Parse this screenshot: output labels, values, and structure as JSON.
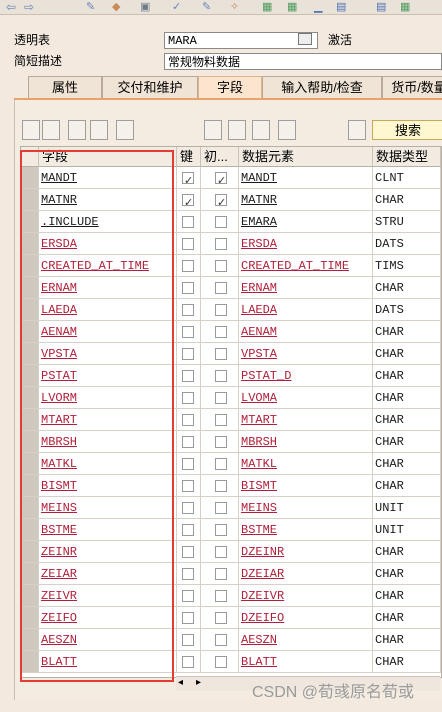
{
  "header": {
    "table_label": "透明表",
    "table_name": "MARA",
    "status": "激活",
    "short_desc_label": "简短描述",
    "short_desc_value": "常规物料数据"
  },
  "tabs": [
    {
      "label": "属性"
    },
    {
      "label": "交付和维护"
    },
    {
      "label": "字段"
    },
    {
      "label": "输入帮助/检查"
    },
    {
      "label": "货币/数量"
    }
  ],
  "toolbar": {
    "search_label": "搜索"
  },
  "grid": {
    "columns": [
      "字段",
      "键",
      "初...",
      "数据元素",
      "数据类型"
    ],
    "rows": [
      {
        "field": "MANDT",
        "key": true,
        "init": true,
        "element": "MANDT",
        "type": "CLNT",
        "red": false
      },
      {
        "field": "MATNR",
        "key": true,
        "init": true,
        "element": "MATNR",
        "type": "CHAR",
        "red": false
      },
      {
        "field": ".INCLUDE",
        "key": false,
        "init": false,
        "element": "EMARA",
        "type": "STRU",
        "red": false
      },
      {
        "field": "ERSDA",
        "key": false,
        "init": false,
        "element": "ERSDA",
        "type": "DATS",
        "red": true
      },
      {
        "field": "CREATED_AT_TIME",
        "key": false,
        "init": false,
        "element": "CREATED_AT_TIME",
        "type": "TIMS",
        "red": true
      },
      {
        "field": "ERNAM",
        "key": false,
        "init": false,
        "element": "ERNAM",
        "type": "CHAR",
        "red": true
      },
      {
        "field": "LAEDA",
        "key": false,
        "init": false,
        "element": "LAEDA",
        "type": "DATS",
        "red": true
      },
      {
        "field": "AENAM",
        "key": false,
        "init": false,
        "element": "AENAM",
        "type": "CHAR",
        "red": true
      },
      {
        "field": "VPSTA",
        "key": false,
        "init": false,
        "element": "VPSTA",
        "type": "CHAR",
        "red": true
      },
      {
        "field": "PSTAT",
        "key": false,
        "init": false,
        "element": "PSTAT_D",
        "type": "CHAR",
        "red": true
      },
      {
        "field": "LVORM",
        "key": false,
        "init": false,
        "element": "LVOMA",
        "type": "CHAR",
        "red": true
      },
      {
        "field": "MTART",
        "key": false,
        "init": false,
        "element": "MTART",
        "type": "CHAR",
        "red": true
      },
      {
        "field": "MBRSH",
        "key": false,
        "init": false,
        "element": "MBRSH",
        "type": "CHAR",
        "red": true
      },
      {
        "field": "MATKL",
        "key": false,
        "init": false,
        "element": "MATKL",
        "type": "CHAR",
        "red": true
      },
      {
        "field": "BISMT",
        "key": false,
        "init": false,
        "element": "BISMT",
        "type": "CHAR",
        "red": true
      },
      {
        "field": "MEINS",
        "key": false,
        "init": false,
        "element": "MEINS",
        "type": "UNIT",
        "red": true
      },
      {
        "field": "BSTME",
        "key": false,
        "init": false,
        "element": "BSTME",
        "type": "UNIT",
        "red": true
      },
      {
        "field": "ZEINR",
        "key": false,
        "init": false,
        "element": "DZEINR",
        "type": "CHAR",
        "red": true
      },
      {
        "field": "ZEIAR",
        "key": false,
        "init": false,
        "element": "DZEIAR",
        "type": "CHAR",
        "red": true
      },
      {
        "field": "ZEIVR",
        "key": false,
        "init": false,
        "element": "DZEIVR",
        "type": "CHAR",
        "red": true
      },
      {
        "field": "ZEIFO",
        "key": false,
        "init": false,
        "element": "DZEIFO",
        "type": "CHAR",
        "red": true
      },
      {
        "field": "AESZN",
        "key": false,
        "init": false,
        "element": "AESZN",
        "type": "CHAR",
        "red": true
      },
      {
        "field": "BLATT",
        "key": false,
        "init": false,
        "element": "BLATT",
        "type": "CHAR",
        "red": true
      }
    ]
  },
  "watermark": "CSDN @荀彧原名荀或",
  "colors": {
    "accent": "#e8a26a",
    "link_red": "#b0203a",
    "highlight_box": "#e53b32"
  }
}
